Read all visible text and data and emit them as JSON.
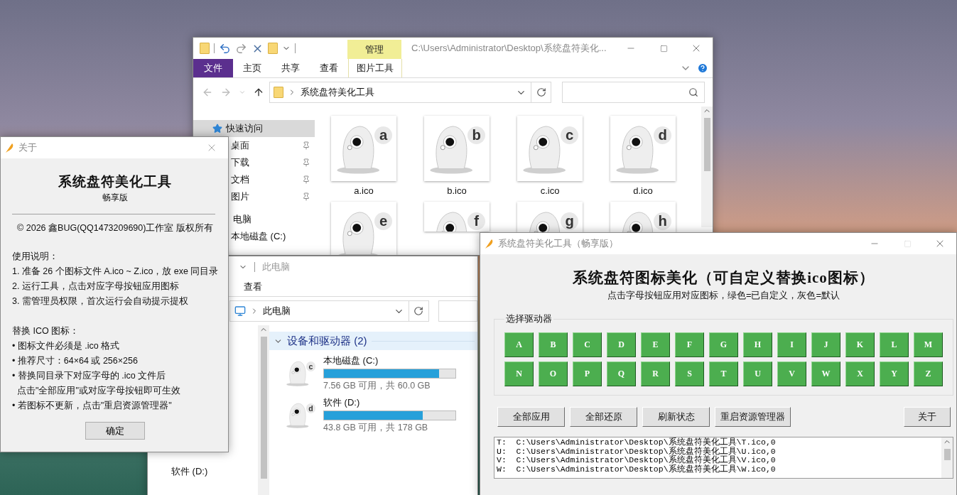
{
  "explorer_folder": {
    "title": "C:\\Users\\Administrator\\Desktop\\系统盘符美化...",
    "context_tab": "管理",
    "ribbon_tabs": [
      {
        "label": "文件",
        "kind": "file"
      },
      {
        "label": "主页",
        "kind": "normal"
      },
      {
        "label": "共享",
        "kind": "normal"
      },
      {
        "label": "查看",
        "kind": "normal"
      },
      {
        "label": "图片工具",
        "kind": "contextual"
      }
    ],
    "address": "系统盘符美化工具",
    "nav": [
      {
        "label": "快速访问",
        "selected": true,
        "children": [
          {
            "label": "桌面",
            "selected": false,
            "pinned": true
          },
          {
            "label": "下载",
            "selected": false,
            "pinned": true
          },
          {
            "label": "文档",
            "selected": false,
            "pinned": true
          },
          {
            "label": "图片",
            "selected": false,
            "pinned": true
          }
        ]
      },
      {
        "label": "电脑",
        "selected": false,
        "children": [
          {
            "label": "本地磁盘 (C:)",
            "selected": false,
            "pinned": false
          }
        ]
      }
    ],
    "files": [
      {
        "name": "a.ico",
        "letter": "a"
      },
      {
        "name": "b.ico",
        "letter": "b"
      },
      {
        "name": "c.ico",
        "letter": "c"
      },
      {
        "name": "d.ico",
        "letter": "d"
      },
      {
        "letter": "e"
      },
      {
        "letter": "f"
      },
      {
        "letter": "g"
      },
      {
        "letter": "h"
      }
    ]
  },
  "explorer_pc": {
    "title": "此电脑",
    "ribbon_tab": "查看",
    "address": "此电脑",
    "nav": [
      {
        "label": "软件 (D:)",
        "selected": false
      }
    ],
    "group": "设备和驱动器 (2)",
    "drives": [
      {
        "name": "本地磁盘 (C:)",
        "icon_letter": "c",
        "level": 0.874,
        "caption": "7.56 GB 可用，共 60.0 GB"
      },
      {
        "name": "软件 (D:)",
        "icon_letter": "d",
        "level": 0.754,
        "caption": "43.8 GB 可用，共 178 GB"
      }
    ]
  },
  "about_dialog": {
    "title": "关于",
    "app_name": "系统盘符美化工具",
    "edition": "畅享版",
    "copyright": "© 2026 鑫BUG(QQ1473209690)工作室 版权所有",
    "usage_heading": "使用说明：",
    "usage_lines": [
      "1. 准备 26 个图标文件 A.ico ~ Z.ico，放 exe 同目录",
      "2. 运行工具，点击对应字母按钮应用图标",
      "3. 需管理员权限，首次运行会自动提示提权"
    ],
    "replace_heading": "替换 ICO 图标：",
    "replace_lines": [
      "• 图标文件必须是 .ico 格式",
      "• 推荐尺寸：64×64 或 256×256",
      "• 替换同目录下对应字母的 .ico 文件后",
      "  点击\"全部应用\"或对应字母按钮即可生效",
      "• 若图标不更新，点击\"重启资源管理器\""
    ],
    "ok_button": "确定"
  },
  "tool_window": {
    "title": "系统盘符美化工具（畅享版）",
    "heading": "系统盘符图标美化（可自定义替换ico图标）",
    "subtitle": "点击字母按钮应用对应图标，绿色=已自定义，灰色=默认",
    "group_label": "选择驱动器",
    "drive_letters": [
      {
        "letter": "A",
        "customized": true
      },
      {
        "letter": "B",
        "customized": true
      },
      {
        "letter": "C",
        "customized": true
      },
      {
        "letter": "D",
        "customized": true
      },
      {
        "letter": "E",
        "customized": true
      },
      {
        "letter": "F",
        "customized": true
      },
      {
        "letter": "G",
        "customized": true
      },
      {
        "letter": "H",
        "customized": true
      },
      {
        "letter": "I",
        "customized": true
      },
      {
        "letter": "J",
        "customized": true
      },
      {
        "letter": "K",
        "customized": true
      },
      {
        "letter": "L",
        "customized": true
      },
      {
        "letter": "M",
        "customized": true
      },
      {
        "letter": "N",
        "customized": true
      },
      {
        "letter": "O",
        "customized": true
      },
      {
        "letter": "P",
        "customized": true
      },
      {
        "letter": "Q",
        "customized": true
      },
      {
        "letter": "R",
        "customized": true
      },
      {
        "letter": "S",
        "customized": true
      },
      {
        "letter": "T",
        "customized": true
      },
      {
        "letter": "U",
        "customized": true
      },
      {
        "letter": "V",
        "customized": true
      },
      {
        "letter": "W",
        "customized": true
      },
      {
        "letter": "X",
        "customized": true
      },
      {
        "letter": "Y",
        "customized": true
      },
      {
        "letter": "Z",
        "customized": true
      }
    ],
    "actions": [
      "全部应用",
      "全部还原",
      "刷新状态",
      "重启资源管理器"
    ],
    "about_button": "关于",
    "log": [
      "T:  C:\\Users\\Administrator\\Desktop\\系统盘符美化工具\\T.ico,0",
      "U:  C:\\Users\\Administrator\\Desktop\\系统盘符美化工具\\U.ico,0",
      "V:  C:\\Users\\Administrator\\Desktop\\系统盘符美化工具\\V.ico,0",
      "W:  C:\\Users\\Administrator\\Desktop\\系统盘符美化工具\\W.ico,0"
    ]
  }
}
